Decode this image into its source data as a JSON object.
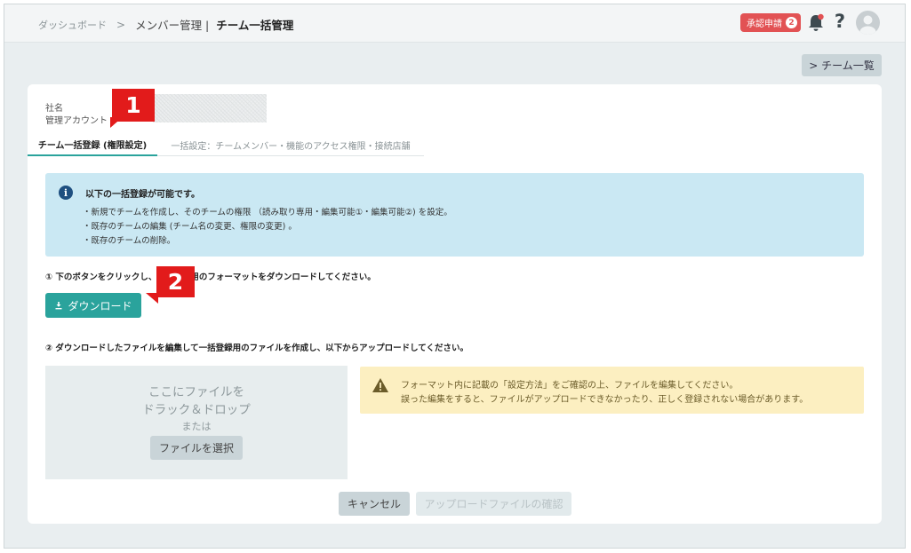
{
  "breadcrumb": {
    "dashboard": "ダッシュボード",
    "separator": ">",
    "members": "メンバー管理 |",
    "current": "チーム一括管理"
  },
  "header": {
    "approval_label": "承認申請",
    "approval_count": "2",
    "help_label": "?"
  },
  "team_list_button": "> チーム一覧",
  "company": {
    "name_label": "社名",
    "account_label": "管理アカウント"
  },
  "tabs": [
    {
      "label": "チーム一括登録 (権限設定)",
      "active": true
    },
    {
      "label": "一括設定：チームメンバー・機能のアクセス権限・接続店舗",
      "active": false
    }
  ],
  "callouts": [
    "1",
    "2"
  ],
  "info": {
    "title": "以下の一括登録が可能です。",
    "lines": [
      "・新規でチームを作成し、そのチームの権限 （読み取り専用・編集可能①・編集可能②) を設定。",
      "・既存のチームの編集 (チーム名の変更、権限の変更) 。",
      "・既存のチームの削除。"
    ]
  },
  "step1": "① 下のボタンをクリックし、一括登録用のフォーマットをダウンロードしてください。",
  "download_button": "ダウンロード",
  "step2": "② ダウンロードしたファイルを編集して一括登録用のファイルを作成し、以下からアップロードしてください。",
  "dropzone": {
    "line1": "ここにファイルを",
    "line2": "ドラック＆ドロップ",
    "or": "または",
    "select_button": "ファイルを選択"
  },
  "warning": {
    "line1": "フォーマット内に記載の「設定方法」をご確認の上、ファイルを編集してください。",
    "line2": "誤った編集をすると、ファイルがアップロードできなかったり、正しく登録されない場合があります。"
  },
  "buttons": {
    "cancel": "キャンセル",
    "confirm": "アップロードファイルの確認"
  },
  "colors": {
    "accent": "#2aa39c",
    "alert": "#e25254",
    "callout": "#e21b1b",
    "info_bg": "#cae8f3",
    "warning_bg": "#fcefc1"
  }
}
